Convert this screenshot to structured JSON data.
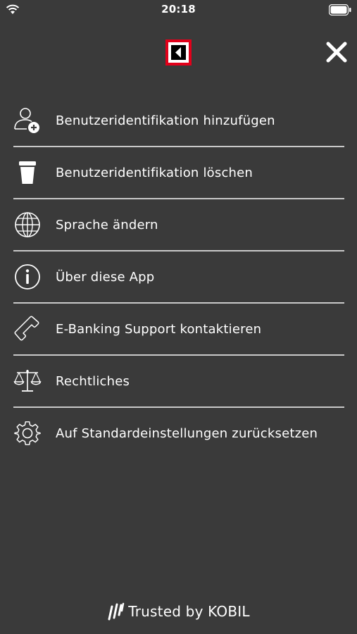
{
  "status_bar": {
    "time": "20:18",
    "wifi_icon": "wifi-icon",
    "battery_icon": "battery-icon"
  },
  "header": {
    "logo_icon": "bank-logo-icon",
    "logo_colors": {
      "frame": "#e2001a",
      "inner": "#ffffff",
      "mark": "#000000"
    },
    "close_icon": "close-icon"
  },
  "menu": {
    "items": [
      {
        "label": "Benutzeridentifikation hinzufügen",
        "icon": "add-user-icon"
      },
      {
        "label": "Benutzeridentifikation löschen",
        "icon": "trash-icon"
      },
      {
        "label": "Sprache ändern",
        "icon": "globe-icon"
      },
      {
        "label": "Über diese App",
        "icon": "info-icon"
      },
      {
        "label": "E-Banking Support kontaktieren",
        "icon": "phone-icon"
      },
      {
        "label": "Rechtliches",
        "icon": "scales-icon"
      },
      {
        "label": "Auf Standardeinstellungen zurücksetzen",
        "icon": "gear-icon"
      }
    ]
  },
  "footer": {
    "text": "Trusted by KOBIL",
    "icon": "kobil-icon"
  },
  "colors": {
    "background": "#3a3a3a",
    "text": "#ffffff",
    "divider": "#c9c9c9"
  }
}
